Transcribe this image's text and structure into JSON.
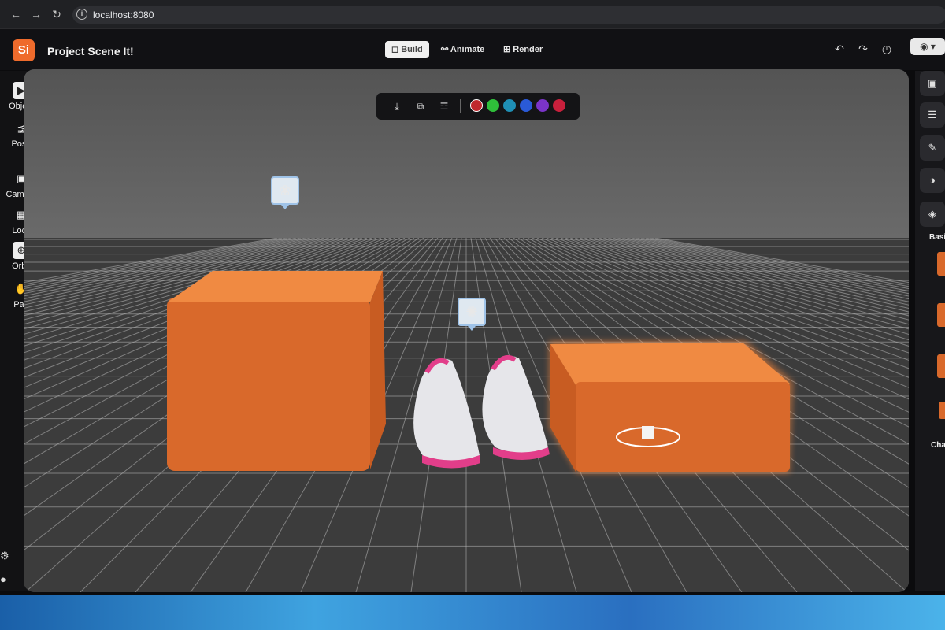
{
  "browser": {
    "url": "localhost:8080",
    "nav_icons": [
      "back-icon",
      "forward-icon",
      "reload-icon"
    ]
  },
  "app": {
    "logo_text": "Si",
    "title": "Project Scene It!",
    "tabs": [
      {
        "label": "Build",
        "icon": "cube-icon",
        "active": true
      },
      {
        "label": "Animate",
        "icon": "animate-icon"
      },
      {
        "label": "Render",
        "icon": "render-icon"
      }
    ],
    "header_icons": [
      "undo-icon",
      "redo-icon",
      "history-icon",
      "eye-icon"
    ]
  },
  "tools": [
    {
      "label": "Object",
      "icon": "cursor-icon",
      "active": true
    },
    {
      "label": "Pose",
      "icon": "pose-icon"
    },
    {
      "label": "Camera",
      "icon": "camera-icon"
    },
    {
      "label": "Lock",
      "icon": "lock-icon"
    },
    {
      "label": "Orbit",
      "icon": "orbit-icon",
      "active": true
    },
    {
      "label": "Pan",
      "icon": "hand-icon"
    }
  ],
  "object_toolbar": {
    "icons": [
      "drop-to-floor-icon",
      "duplicate-icon",
      "trash-icon"
    ],
    "colors": [
      "#c0282d",
      "#2fbf3a",
      "#1f8fb5",
      "#2a5ad8",
      "#7b34c8",
      "#c8203c"
    ],
    "selected_color": "#c0282d"
  },
  "right_panel": {
    "buttons": [
      "cube-icon",
      "layers-icon",
      "brush-icon",
      "material-icon",
      "shape-icon"
    ],
    "text_labels": [
      "Basi",
      "Cha"
    ]
  },
  "scene": {
    "objects": [
      "Box",
      "Sneakers",
      "Box (selected)"
    ],
    "thumbnails": [
      "flower-thumbnail",
      "sneaker-thumbnail"
    ]
  }
}
